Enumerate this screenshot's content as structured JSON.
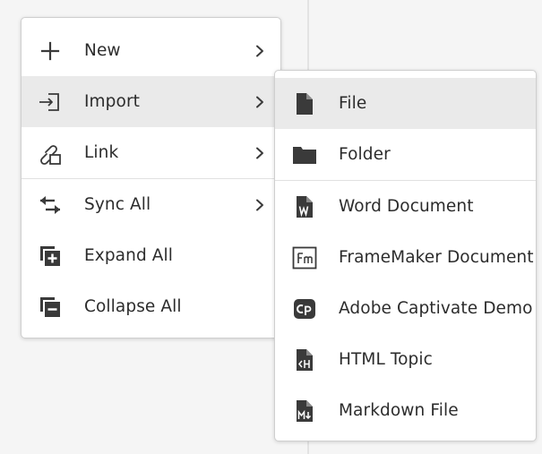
{
  "main_menu": {
    "items": [
      {
        "label": "New",
        "icon": "plus-icon",
        "has_submenu": true
      },
      {
        "label": "Import",
        "icon": "import-icon",
        "has_submenu": true,
        "active": true
      },
      {
        "label": "Link",
        "icon": "link-icon",
        "has_submenu": true
      },
      {
        "label": "Sync All",
        "icon": "sync-icon",
        "has_submenu": true
      },
      {
        "label": "Expand All",
        "icon": "expand-all-icon",
        "has_submenu": false
      },
      {
        "label": "Collapse All",
        "icon": "collapse-all-icon",
        "has_submenu": false
      }
    ]
  },
  "import_submenu": {
    "items": [
      {
        "label": "File",
        "icon": "file-icon",
        "active": true
      },
      {
        "label": "Folder",
        "icon": "folder-icon"
      },
      {
        "label": "Word Document",
        "icon": "word-document-icon"
      },
      {
        "label": "FrameMaker Document",
        "icon": "framemaker-icon"
      },
      {
        "label": "Adobe Captivate Demo",
        "icon": "captivate-icon"
      },
      {
        "label": "HTML Topic",
        "icon": "html-topic-icon"
      },
      {
        "label": "Markdown File",
        "icon": "markdown-file-icon"
      }
    ]
  },
  "colors": {
    "icon": "#3a3a3a",
    "active_row": "#eaeaea",
    "text": "#2c2c2c",
    "background": "#f5f5f5"
  }
}
